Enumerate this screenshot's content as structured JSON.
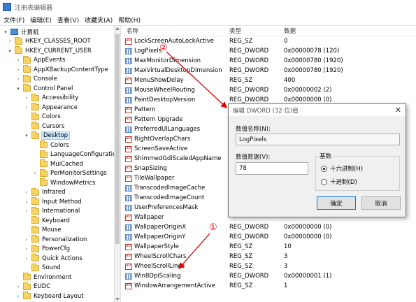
{
  "window": {
    "title": "注册表编辑器"
  },
  "menu": [
    "文件(F)",
    "编辑(E)",
    "查看(V)",
    "收藏夹(A)",
    "帮助(H)"
  ],
  "tree": [
    {
      "label": "计算机",
      "twisty": "▾",
      "kind": "pc"
    },
    {
      "label": "HKEY_CLASSES_ROOT",
      "twisty": "›",
      "kind": "folder"
    },
    {
      "label": "HKEY_CURRENT_USER",
      "twisty": "▾",
      "kind": "folder"
    },
    {
      "label": "AppEvents",
      "twisty": "›",
      "kind": "folder"
    },
    {
      "label": "AppXBackupContentType",
      "twisty": "›",
      "kind": "folder"
    },
    {
      "label": "Console",
      "twisty": "›",
      "kind": "folder"
    },
    {
      "label": "Control Panel",
      "twisty": "▾",
      "kind": "folder"
    },
    {
      "label": "Accessibility",
      "twisty": "›",
      "kind": "folder"
    },
    {
      "label": "Appearance",
      "twisty": "›",
      "kind": "folder"
    },
    {
      "label": "Colors",
      "twisty": "",
      "kind": "folder"
    },
    {
      "label": "Cursors",
      "twisty": "",
      "kind": "folder"
    },
    {
      "label": "Desktop",
      "twisty": "▾",
      "kind": "folder",
      "selected": true
    },
    {
      "label": "Colors",
      "twisty": "",
      "kind": "folder"
    },
    {
      "label": "LanguageConfiguratio",
      "twisty": "",
      "kind": "folder"
    },
    {
      "label": "MuiCached",
      "twisty": "",
      "kind": "folder"
    },
    {
      "label": "PerMonitorSettings",
      "twisty": "›",
      "kind": "folder"
    },
    {
      "label": "WindowMetrics",
      "twisty": "",
      "kind": "folder"
    },
    {
      "label": "Infrared",
      "twisty": "›",
      "kind": "folder"
    },
    {
      "label": "Input Method",
      "twisty": "›",
      "kind": "folder"
    },
    {
      "label": "International",
      "twisty": "›",
      "kind": "folder"
    },
    {
      "label": "Keyboard",
      "twisty": "",
      "kind": "folder"
    },
    {
      "label": "Mouse",
      "twisty": "",
      "kind": "folder"
    },
    {
      "label": "Personalization",
      "twisty": "›",
      "kind": "folder"
    },
    {
      "label": "PowerCfg",
      "twisty": "›",
      "kind": "folder"
    },
    {
      "label": "Quick Actions",
      "twisty": "›",
      "kind": "folder"
    },
    {
      "label": "Sound",
      "twisty": "",
      "kind": "folder"
    },
    {
      "label": "Environment",
      "twisty": "",
      "kind": "folder"
    },
    {
      "label": "EUDC",
      "twisty": "›",
      "kind": "folder"
    },
    {
      "label": "Keyboard Layout",
      "twisty": "›",
      "kind": "folder"
    }
  ],
  "list": {
    "headers": {
      "name": "名称",
      "type": "类型",
      "data": "数据"
    },
    "rows": [
      {
        "name": "LockScreenAutoLockActive",
        "type": "REG_SZ",
        "data": "0",
        "icon": "reg-sz-icon"
      },
      {
        "name": "LogPixels",
        "type": "REG_DWORD",
        "data": "0x00000078 (120)",
        "icon": "reg-dword-icon"
      },
      {
        "name": "MaxMonitorDimension",
        "type": "REG_DWORD",
        "data": "0x00000780 (1920)",
        "icon": "reg-dword-icon"
      },
      {
        "name": "MaxVirtualDesktopDimension",
        "type": "REG_DWORD",
        "data": "0x00000780 (1920)",
        "icon": "reg-dword-icon"
      },
      {
        "name": "MenuShowDelay",
        "type": "REG_SZ",
        "data": "400",
        "icon": "reg-sz-icon"
      },
      {
        "name": "MouseWheelRouting",
        "type": "REG_DWORD",
        "data": "0x00000002 (2)",
        "icon": "reg-dword-icon"
      },
      {
        "name": "PaintDesktopVersion",
        "type": "REG_DWORD",
        "data": "0x00000000 (0)",
        "icon": "reg-dword-icon"
      },
      {
        "name": "Pattern",
        "type": "",
        "data": "",
        "icon": "reg-sz-icon"
      },
      {
        "name": "Pattern Upgrade",
        "type": "",
        "data": "",
        "icon": "reg-sz-icon"
      },
      {
        "name": "PreferredUILanguages",
        "type": "",
        "data": "",
        "icon": "reg-dword-icon"
      },
      {
        "name": "RightOverlapChars",
        "type": "",
        "data": "",
        "icon": "reg-sz-icon"
      },
      {
        "name": "ScreenSaveActive",
        "type": "",
        "data": "",
        "icon": "reg-sz-icon"
      },
      {
        "name": "ShimmedGdiScaledAppName",
        "type": "",
        "data": "",
        "icon": "reg-sz-icon"
      },
      {
        "name": "SnapSizing",
        "type": "",
        "data": "",
        "icon": "reg-sz-icon"
      },
      {
        "name": "TileWallpaper",
        "type": "",
        "data": "",
        "icon": "reg-sz-icon"
      },
      {
        "name": "TranscodedImageCache",
        "type": "",
        "data": "",
        "icon": "reg-dword-icon"
      },
      {
        "name": "TranscodedImageCount",
        "type": "",
        "data": "",
        "icon": "reg-dword-icon"
      },
      {
        "name": "UserPreferencesMask",
        "type": "",
        "data": "",
        "icon": "reg-dword-icon"
      },
      {
        "name": "Wallpaper",
        "type": "",
        "data": "",
        "icon": "reg-sz-icon"
      },
      {
        "name": "WallpaperOriginX",
        "type": "REG_DWORD",
        "data": "0x00000000 (0)",
        "icon": "reg-dword-icon"
      },
      {
        "name": "WallpaperOriginY",
        "type": "REG_DWORD",
        "data": "0x00000000 (0)",
        "icon": "reg-dword-icon"
      },
      {
        "name": "WallpaperStyle",
        "type": "REG_SZ",
        "data": "10",
        "icon": "reg-sz-icon"
      },
      {
        "name": "WheelScrollChars",
        "type": "REG_SZ",
        "data": "3",
        "icon": "reg-sz-icon"
      },
      {
        "name": "WheelScrollLines",
        "type": "REG_SZ",
        "data": "3",
        "icon": "reg-sz-icon"
      },
      {
        "name": "Win8DpiScaling",
        "type": "REG_DWORD",
        "data": "0x00000001 (1)",
        "icon": "reg-dword-icon"
      },
      {
        "name": "WindowArrangementActive",
        "type": "REG_SZ",
        "data": "1",
        "icon": "reg-sz-icon"
      }
    ]
  },
  "dialog": {
    "title": "编辑 DWORD (32 位)值",
    "close": "✕",
    "name_label": "数值名称(N):",
    "name_value": "LogPixels",
    "data_label": "数值数据(V):",
    "data_value": "78",
    "base_label": "基数",
    "hex_label": "十六进制(H)",
    "dec_label": "十进制(D)",
    "ok_label": "确定",
    "cancel_label": "取消",
    "selected_base": "hex"
  },
  "annotations": {
    "one": "①",
    "two": "②",
    "color": "#dd0000"
  }
}
